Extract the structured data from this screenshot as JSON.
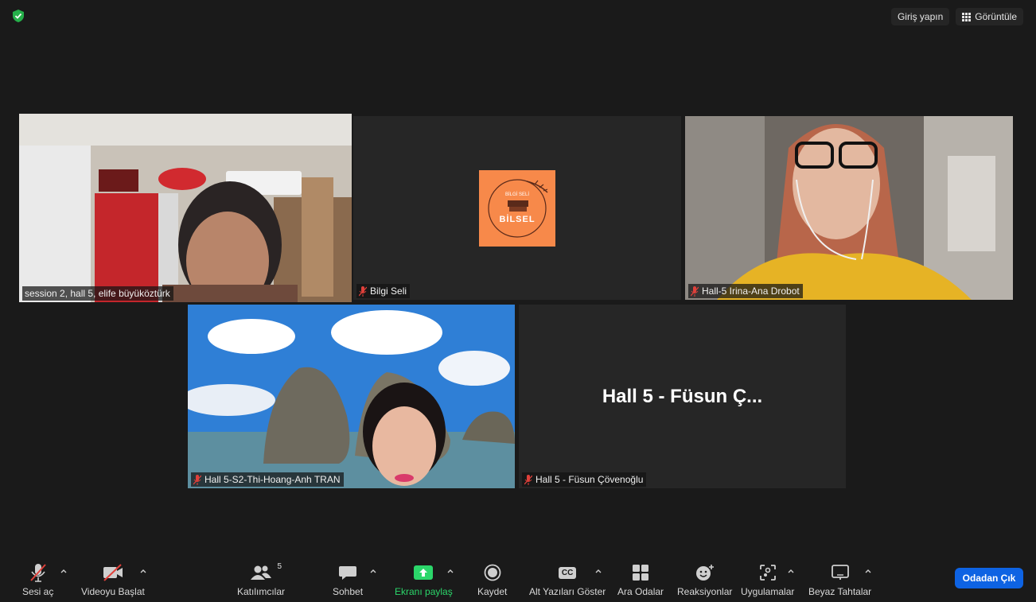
{
  "topbar": {
    "signin_label": "Giriş yapın",
    "view_label": "Görüntüle"
  },
  "participants": [
    {
      "name": "session 2, hall 5, elife büyüköztürk",
      "video": "on",
      "speaking": true
    },
    {
      "name": "Bilgi Seli",
      "video": "logo",
      "logo_text_top": "BİLGİ SELİ",
      "logo_text_main": "BİLSEL",
      "logo_color": "#f7894a"
    },
    {
      "name": "Hall-5 Irina-Ana Drobot",
      "video": "on"
    },
    {
      "name": "Hall 5-S2-Thi-Hoang-Anh TRAN",
      "video": "on"
    },
    {
      "name": "Hall 5 - Füsun Çövenoğlu",
      "video": "off",
      "display_name": "Hall 5 - Füsun Ç..."
    }
  ],
  "toolbar": {
    "mute": "Sesi aç",
    "video": "Videoyu Başlat",
    "participants": "Katılımcılar",
    "participants_count": "5",
    "chat": "Sohbet",
    "share": "Ekranı paylaş",
    "record": "Kaydet",
    "captions": "Alt Yazıları Göster",
    "captions_icon_text": "CC",
    "breakout": "Ara Odalar",
    "reactions": "Reaksiyonlar",
    "apps": "Uygulamalar",
    "whiteboards": "Beyaz Tahtalar",
    "leave": "Odadan Çık"
  },
  "colors": {
    "accent_blue": "#0e63e3",
    "share_green": "#2bd66a",
    "active_border": "#d6ea7a",
    "muted_red": "#e0403a"
  }
}
